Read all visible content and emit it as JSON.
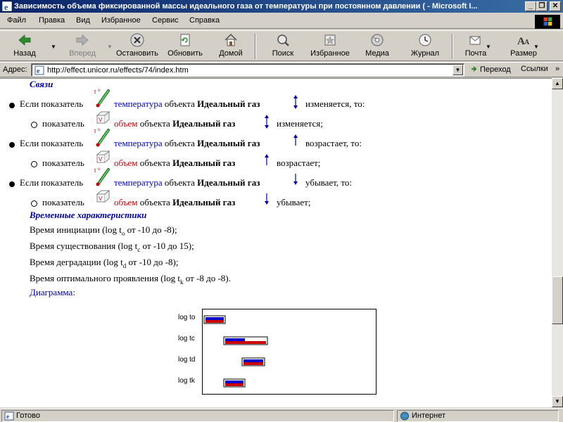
{
  "window": {
    "title": "Зависимость объема фиксированной массы идеального газа от температуры при постоянном давлении ( - Microsoft I...",
    "controls": [
      "_",
      "❐",
      "✕"
    ]
  },
  "menu": [
    "Файл",
    "Правка",
    "Вид",
    "Избранное",
    "Сервис",
    "Справка"
  ],
  "toolbar": {
    "back": "Назад",
    "forward": "Вперед",
    "stop": "Остановить",
    "refresh": "Обновить",
    "home": "Домой",
    "search": "Поиск",
    "favorites": "Избранное",
    "media": "Медиа",
    "history": "Журнал",
    "mail": "Почта",
    "size": "Размер"
  },
  "address": {
    "label": "Адрес:",
    "url": "http://effect.unicor.ru/effects/74/index.htm",
    "go": "Переход",
    "links": "Ссылки"
  },
  "content": {
    "links_title": "Связи",
    "if_prefix": "Если показатель",
    "indicator_prefix": "показатель",
    "temperature": "температура",
    "volume": "объем",
    "of_object": "объекта",
    "object_name": "Идеальный газ",
    "rules": [
      {
        "t_change": "изменяется, то:",
        "v_change": "изменяется;"
      },
      {
        "t_change": "возрастает, то:",
        "v_change": "возрастает;"
      },
      {
        "t_change": "убывает, то:",
        "v_change": "убывает;"
      }
    ],
    "time_title": "Временные характеристики",
    "times": [
      {
        "pre": "Время инициации (log t",
        "sub": "o",
        "post": " от -10 до -8);"
      },
      {
        "pre": "Время существования (log t",
        "sub": "c",
        "post": " от -10 до 15);"
      },
      {
        "pre": "Время деградации (log t",
        "sub": "d",
        "post": " от -10 до -8);"
      },
      {
        "pre": "Время оптимального проявления (log t",
        "sub": "k",
        "post": " от -8 до -8)."
      }
    ],
    "diagram_label": "Диаграмма:"
  },
  "chart_data": {
    "type": "bar",
    "categories": [
      "log to",
      "log tc",
      "log td",
      "log tk"
    ],
    "series": [
      {
        "color": "#0000cc",
        "ranges": [
          [
            -10,
            -8
          ],
          [
            -10,
            15
          ],
          [
            -10,
            -8
          ],
          [
            -8,
            -8
          ]
        ]
      },
      {
        "color": "#cc0000",
        "ranges": [
          [
            -10,
            -8
          ],
          [
            -10,
            15
          ],
          [
            -10,
            -8
          ],
          [
            -8,
            -8
          ]
        ]
      }
    ]
  },
  "status": {
    "ready": "Готово",
    "zone": "Интернет"
  }
}
